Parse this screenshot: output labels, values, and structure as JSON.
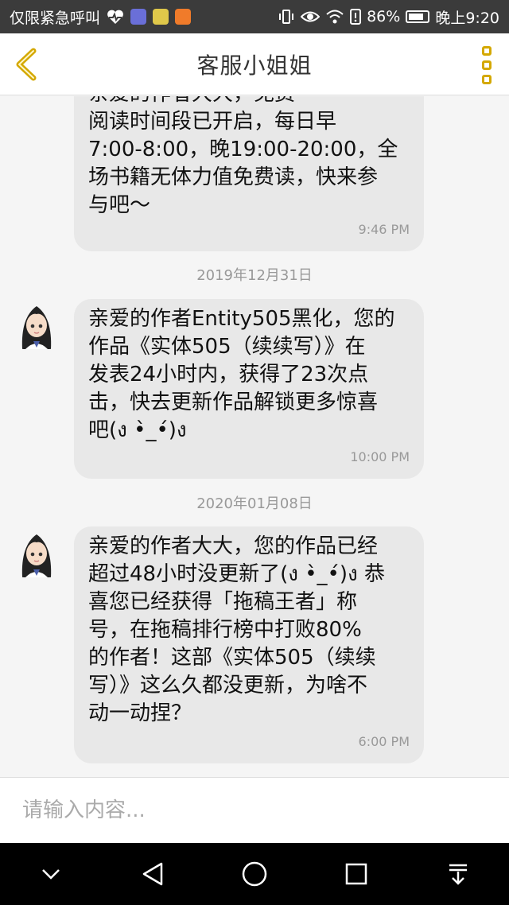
{
  "status_bar": {
    "carrier": "仅限紧急呼叫",
    "battery": "86%",
    "time": "晚上9:20",
    "icons": [
      "heartbeat-icon",
      "music-app-icon",
      "chat-app-icon",
      "video-app-icon",
      "vibrate-icon",
      "eye-icon",
      "wifi-icon",
      "alert-icon",
      "battery-icon"
    ]
  },
  "header": {
    "title": "客服小姐姐",
    "back_icon": "chevron-left-icon",
    "more_icon": "more-vertical-icon",
    "accent": "#d4a800"
  },
  "messages": [
    {
      "text": "亲爱的作者大大，免费\n阅读时间段已开启，每日早\n7:00-8:00，晚19:00-20:00，全\n场书籍无体力值免费读，快来参\n与吧～",
      "time": "9:46 PM"
    },
    {
      "date": "2019年12月31日",
      "text": "亲爱的作者Entity505黑化，您的\n作品《实体505（续续写）》在\n发表24小时内，获得了23次点\n击，快去更新作品解锁更多惊喜\n吧(ง •̀_•́)ง",
      "time": "10:00 PM"
    },
    {
      "date": "2020年01月08日",
      "text": "亲爱的作者大大，您的作品已经\n超过48小时没更新了(ง •̀_•́)ง 恭\n喜您已经获得「拖稿王者」称\n号，在拖稿排行榜中打败80%\n的作者！这部《实体505（续续\n写）》这么久都没更新，为啥不\n动一动捏？",
      "time": "6:00 PM"
    }
  ],
  "input": {
    "placeholder": "请输入内容..."
  },
  "nav_bar": {
    "icons": [
      "chevron-down-icon",
      "back-triangle-icon",
      "home-circle-icon",
      "recents-square-icon",
      "notification-pull-icon"
    ]
  }
}
